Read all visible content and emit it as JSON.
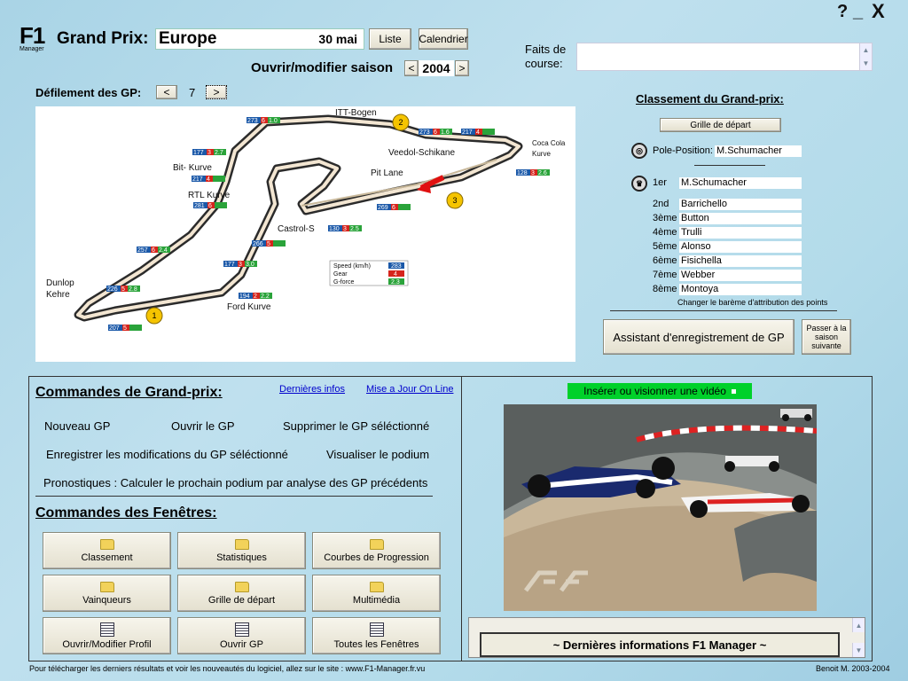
{
  "window_controls": {
    "help": "?",
    "minimize": "_",
    "close": "X"
  },
  "logo": {
    "f1": "F1",
    "manager": "Manager"
  },
  "gp": {
    "label": "Grand Prix:",
    "name": "Europe",
    "date": "30 mai",
    "list_btn": "Liste",
    "calendar_btn": "Calendrier"
  },
  "season": {
    "label": "Ouvrir/modifier saison",
    "prev": "<",
    "year": "2004",
    "next": ">"
  },
  "scroll_gp": {
    "label": "Défilement des GP:",
    "prev": "<",
    "num": "7",
    "next": ">"
  },
  "track": {
    "corners": [
      "ITT-Bogen",
      "Veedol-Schikane",
      "Coca Cola",
      "Kurve",
      "Bit- Kurve",
      "RTL Kurve",
      "Pit Lane",
      "Castrol-S",
      "Dunlop",
      "Kehre",
      "Ford Kurve"
    ],
    "markers": [
      "1",
      "2",
      "3"
    ],
    "speeds": [
      "273",
      "217",
      "177",
      "217",
      "281",
      "257",
      "226",
      "207",
      "194",
      "177",
      "266",
      "130",
      "269",
      "273",
      "128"
    ],
    "gears": [
      "6",
      "4",
      "3",
      "4",
      "6",
      "6",
      "5",
      "5",
      "2",
      "3",
      "5",
      "3",
      "6",
      "6",
      "3"
    ],
    "gforces": [
      "1.0",
      "",
      "2.7",
      "",
      "",
      "2.4",
      "2.8",
      "",
      "2.2",
      "3.0",
      "",
      "2.5",
      "",
      "1.6",
      "2.6"
    ],
    "legend": {
      "speed": "Speed (km/h)",
      "speed_v": "283",
      "gear": "Gear",
      "gear_v": "4",
      "gforce": "G-force",
      "gforce_v": "2.3"
    }
  },
  "faits": {
    "label1": "Faits de",
    "label2": "course:",
    "value": ""
  },
  "classement": {
    "title": "Classement du Grand-prix:",
    "grille_btn": "Grille de départ",
    "pole_label": "Pole-Position:",
    "pole_value": "M.Schumacher",
    "rows": [
      {
        "rank": "1er",
        "name": "M.Schumacher"
      },
      {
        "rank": "2nd",
        "name": "Barrichello"
      },
      {
        "rank": "3ème",
        "name": "Button"
      },
      {
        "rank": "4ème",
        "name": "Trulli"
      },
      {
        "rank": "5ème",
        "name": "Alonso"
      },
      {
        "rank": "6ème",
        "name": "Fisichella"
      },
      {
        "rank": "7ème",
        "name": "Webber"
      },
      {
        "rank": "8ème",
        "name": "Montoya"
      }
    ],
    "bareme": "Changer le barème d'attribution des points"
  },
  "assistant_btn": "Assistant d'enregistrement de GP",
  "next_season_btn": {
    "l1": "Passer à la",
    "l2": "saison",
    "l3": "suivante"
  },
  "commands_gp": {
    "title": "Commandes de Grand-prix:",
    "link_infos": "Dernières infos",
    "link_maj": "Mise a Jour On Line",
    "nouveau": "Nouveau GP",
    "ouvrir": "Ouvrir le GP",
    "supprimer": "Supprimer le GP séléctionné",
    "enregistrer": "Enregistrer les modifications du GP séléctionné",
    "podium": "Visualiser le podium",
    "pronostiques": "Pronostiques : Calculer le prochain podium par analyse des GP précédents"
  },
  "commands_win": {
    "title": "Commandes des Fenêtres:",
    "tiles": [
      {
        "label": "Classement",
        "icon": "folder-icon"
      },
      {
        "label": "Statistiques",
        "icon": "folder-icon"
      },
      {
        "label": "Courbes de Progression",
        "icon": "folder-icon"
      },
      {
        "label": "Vainqueurs",
        "icon": "folder-icon"
      },
      {
        "label": "Grille de départ",
        "icon": "folder-icon"
      },
      {
        "label": "Multimédia",
        "icon": "folder-icon"
      },
      {
        "label": "Ouvrir/Modifier Profil",
        "icon": "document-icon"
      },
      {
        "label": "Ouvrir GP",
        "icon": "document-icon"
      },
      {
        "label": "Toutes les Fenêtres",
        "icon": "document-icon"
      }
    ]
  },
  "video_btn": "Insérer ou visionner une vidéo",
  "news_title": "~ Dernières informations F1 Manager ~",
  "footer": {
    "left": "Pour télécharger les derniers résultats et voir les nouveautés du logiciel, allez sur le site : www.F1-Manager.fr.vu",
    "right": "Benoit M. 2003-2004"
  }
}
